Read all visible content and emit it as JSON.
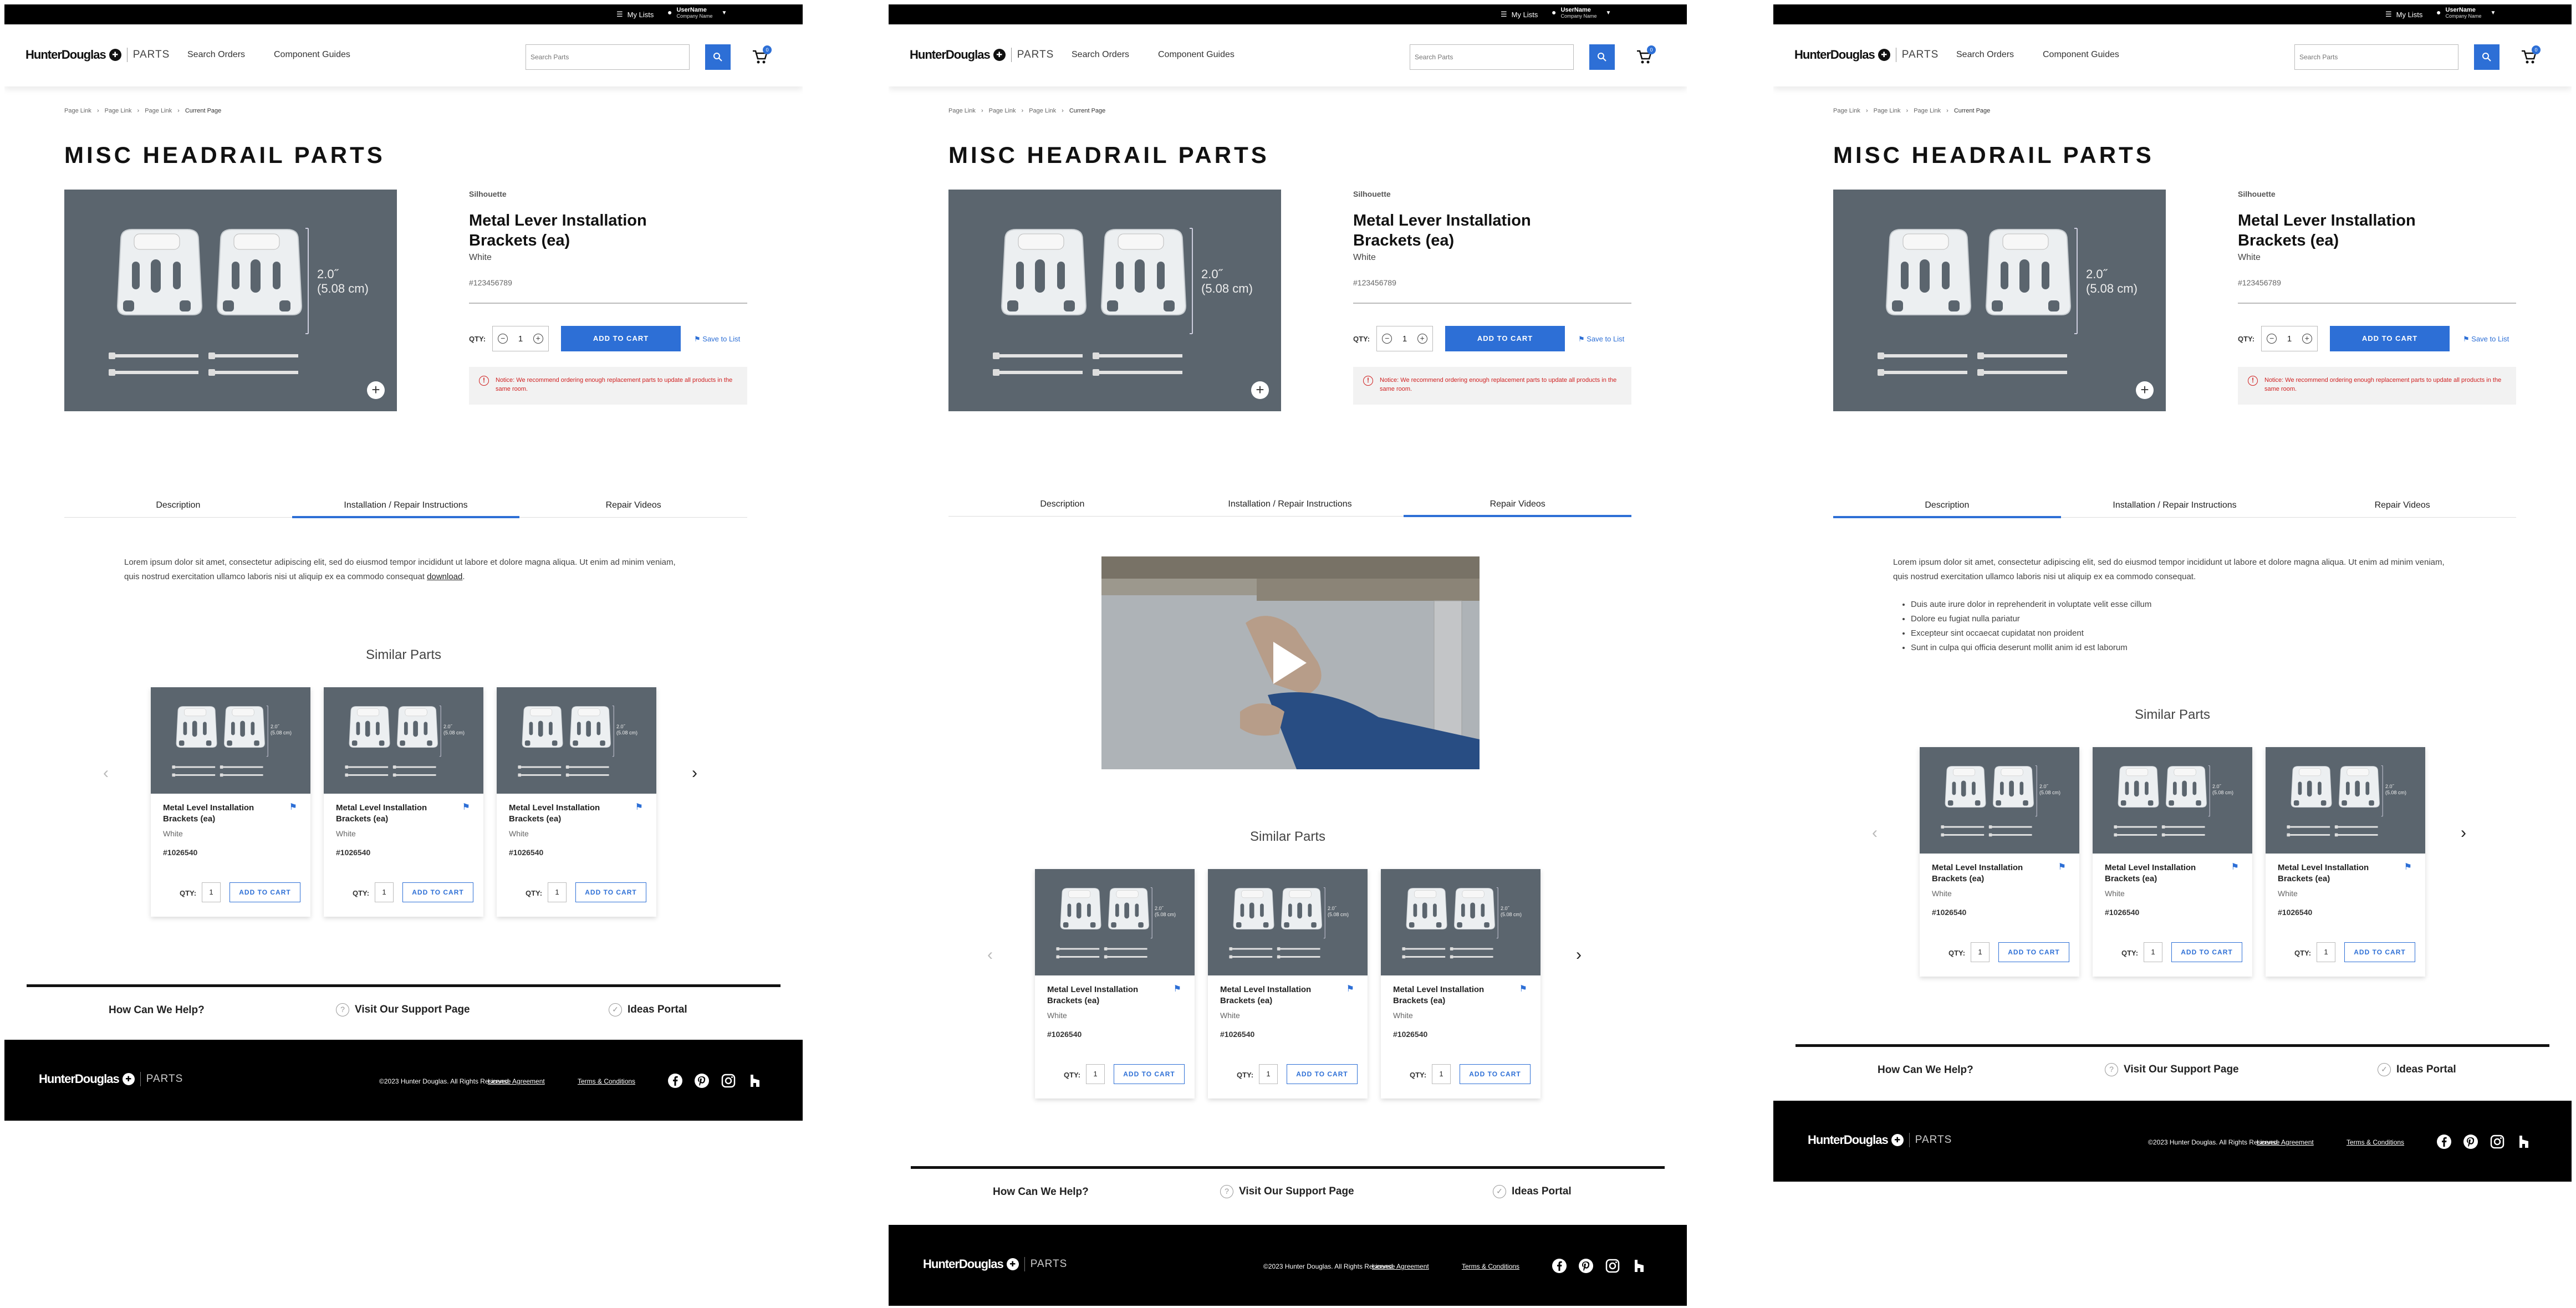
{
  "utility_bar": {
    "my_lists": "My Lists",
    "user_name": "UserName",
    "company": "Company Name"
  },
  "brand": {
    "name": "HunterDouglas",
    "mark": "✚",
    "parts": "PARTS"
  },
  "nav": {
    "search_orders": "Search Orders",
    "component_guides": "Component Guides"
  },
  "search": {
    "placeholder": "Search Parts"
  },
  "cart": {
    "count": "0"
  },
  "breadcrumb": {
    "link1": "Page Link",
    "link2": "Page Link",
    "link3": "Page Link",
    "current": "Current Page"
  },
  "page": {
    "title": "MISC HEADRAIL PARTS"
  },
  "product": {
    "brand": "Silhouette",
    "name": "Metal Lever Installation Brackets (ea)",
    "color": "White",
    "sku": "#123456789",
    "dim_in": "2.0˝",
    "dim_cm": "(5.08 cm)",
    "qty_label": "QTY:",
    "qty": "1",
    "add_to_cart": "ADD TO CART",
    "save_to_list": "Save to List",
    "notice": "Notice: We recommend ordering enough replacement parts to update all products in the same room."
  },
  "tabs": {
    "description": "Description",
    "install": "Installation / Repair Instructions",
    "videos": "Repair Videos"
  },
  "content": {
    "install_text": "Lorem ipsum dolor sit amet, consectetur adipiscing elit, sed do eiusmod tempor incididunt ut labore et dolore magna aliqua. Ut enim ad minim veniam, quis nostrud exercitation ullamco laboris nisi ut aliquip ex ea commodo consequat",
    "download": "download",
    "desc_text": "Lorem ipsum dolor sit amet, consectetur adipiscing elit, sed do eiusmod tempor incididunt ut labore et dolore magna aliqua. Ut enim ad minim veniam, quis nostrud exercitation ullamco laboris nisi ut aliquip ex ea commodo consequat.",
    "bullets": [
      "Duis aute irure dolor in reprehenderit in voluptate velit esse cillum",
      "Dolore eu fugiat nulla pariatur",
      "Excepteur sint occaecat cupidatat non proident",
      "Sunt in culpa qui officia deserunt mollit anim id est laborum"
    ]
  },
  "similar": {
    "heading": "Similar Parts",
    "card": {
      "name": "Metal Level Installation Brackets (ea)",
      "color": "White",
      "sku": "#1026540",
      "qty_label": "QTY:",
      "qty": "1",
      "add": "ADD TO CART",
      "dim_in": "2.0˝",
      "dim_cm": "(5.08 cm)"
    }
  },
  "help": {
    "title": "How Can We Help?",
    "support": "Visit Our Support Page",
    "ideas": "Ideas Portal"
  },
  "footer": {
    "copyright": "©2023 Hunter Douglas. All Rights Reserved.",
    "license": "License Agreement",
    "terms": "Terms & Conditions"
  },
  "colors": {
    "accent": "#2d6fd6",
    "image_bg": "#5b656e",
    "notice": "#d02020"
  }
}
